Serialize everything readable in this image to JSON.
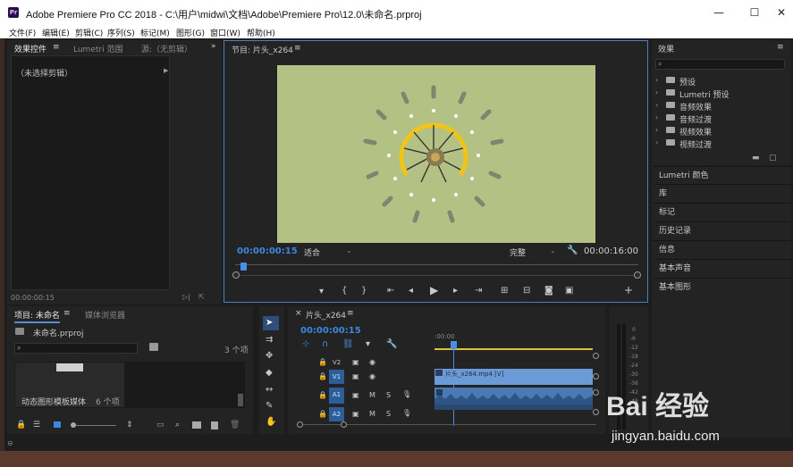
{
  "window": {
    "title": "Adobe Premiere Pro CC 2018 - C:\\用户\\midwi\\文档\\Adobe\\Premiere Pro\\12.0\\未命名.prproj",
    "logo": "Pr",
    "minimize": "—",
    "maximize": "☐",
    "close": "✕"
  },
  "menu": [
    "文件(F)",
    "编辑(E)",
    "剪辑(C)",
    "序列(S)",
    "标记(M)",
    "图形(G)",
    "窗口(W)",
    "帮助(H)"
  ],
  "effect_controls": {
    "tab_active": "效果控件",
    "tab2": "Lumetri 范围",
    "tab3": "源:（无剪辑）",
    "no_clip": "（未选择剪辑）",
    "timecode": "00:00:00:15"
  },
  "program": {
    "title": "节目: 片头_x264",
    "timecode": "00:00:00:15",
    "fit": "适合",
    "quality": "完整",
    "duration": "00:00:16:00"
  },
  "effects_panel": {
    "title": "效果",
    "items": [
      {
        "label": "预设",
        "icon": "folder-icon"
      },
      {
        "label": "Lumetri 预设",
        "icon": "folder-icon"
      },
      {
        "label": "音频效果",
        "icon": "folder-icon"
      },
      {
        "label": "音频过渡",
        "icon": "folder-icon"
      },
      {
        "label": "视频效果",
        "icon": "folder-icon"
      },
      {
        "label": "视频过渡",
        "icon": "folder-icon"
      }
    ],
    "sections": [
      "Lumetri 颜色",
      "库",
      "标记",
      "历史记录",
      "信息",
      "基本声音",
      "基本图形"
    ]
  },
  "project": {
    "tab_active": "项目: 未命名",
    "tab2": "媒体浏览器",
    "file": "未命名.prproj",
    "count": "3 个项",
    "bin_name": "动态图形模板媒体",
    "bin_count": "6 个项"
  },
  "timeline": {
    "title": "片头_x264",
    "timecode": "00:00:00:15",
    "ruler_start": ":00:00",
    "tracks": [
      "V2",
      "V1",
      "A1",
      "A2"
    ],
    "clip_label": "片头_x264.mp4 [V]",
    "meter_labels": [
      "0",
      "-6",
      "-12",
      "-18",
      "-24",
      "-30",
      "-36",
      "-42",
      "-48"
    ]
  },
  "watermark": {
    "brand": "Bai 经验",
    "url": "jingyan.baidu.com"
  },
  "colors": {
    "accent": "#3a88e0",
    "video_bg": "#b4c185",
    "clip_video": "#6b9bd6",
    "clip_audio": "#4a7ab4"
  }
}
